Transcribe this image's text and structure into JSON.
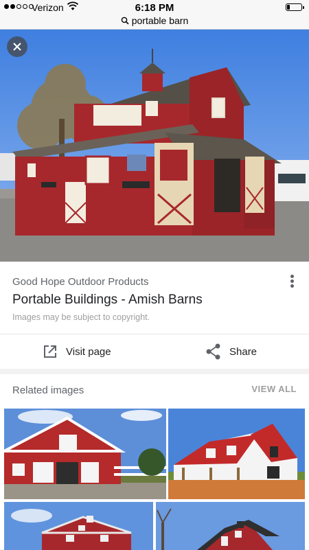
{
  "status_bar": {
    "carrier": "Verizon",
    "time": "6:18 PM",
    "battery_level": 0.2
  },
  "url_bar": {
    "query": "portable barn",
    "icon": "search-icon"
  },
  "hero": {
    "close_icon": "close-icon"
  },
  "result": {
    "source": "Good Hope Outdoor Products",
    "title": "Portable Buildings - Amish Barns",
    "copyright_note": "Images may be subject to copyright.",
    "more_icon": "more-vert-icon"
  },
  "actions": {
    "visit_label": "Visit page",
    "share_label": "Share"
  },
  "related": {
    "title": "Related images",
    "view_all_label": "VIEW ALL"
  },
  "colors": {
    "barn_red": "#a7282c",
    "sky_blue": "#5f8fd8",
    "text_primary": "#202124",
    "text_secondary": "#5f6368"
  }
}
